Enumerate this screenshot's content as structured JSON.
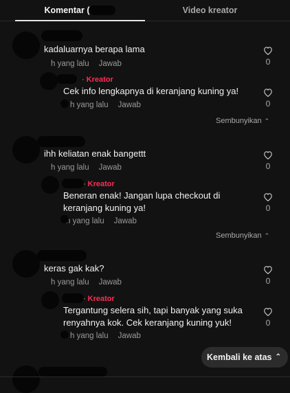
{
  "tabs": [
    {
      "label": "Komentar (",
      "active": true
    },
    {
      "label": "Video kreator",
      "active": false
    }
  ],
  "threads": [
    {
      "comment": {
        "text": "kadaluarnya berapa lama",
        "time": "h yang lalu",
        "reply": "Jawab",
        "likes": "0"
      },
      "creator_reply": {
        "badge": "Kreator",
        "text_lines": [
          "Cek info lengkapnya di keranjang kuning ya!"
        ],
        "time": "h yang lalu",
        "reply": "Jawab",
        "likes": "0"
      },
      "hide_label": "Sembunyikan"
    },
    {
      "comment": {
        "text": "ihh keliatan enak bangettt",
        "time": "h yang lalu",
        "reply": "Jawab",
        "likes": "0"
      },
      "creator_reply": {
        "badge": "Kreator",
        "text_lines": [
          "Beneran enak! Jangan lupa checkout di",
          "keranjang kuning ya!"
        ],
        "time": "h yang lalu",
        "reply": "Jawab",
        "likes": "0"
      },
      "hide_label": "Sembunyikan"
    },
    {
      "comment": {
        "text": "keras gak kak?",
        "time": "h yang lalu",
        "reply": "Jawab",
        "likes": "0"
      },
      "creator_reply": {
        "badge": "Kreator",
        "text_lines": [
          "Tergantung selera sih, tapi banyak yang suka",
          "renyahnya kok. Cek keranjang kuning yuk!"
        ],
        "time": "h yang lalu",
        "reply": "Jawab",
        "likes": "0"
      }
    }
  ],
  "back_to_top": "Kembali ke atas",
  "icons": {
    "like": "heart-outline-icon",
    "hide": "chevron-up-icon",
    "back": "double-chevron-up-icon"
  },
  "colors": {
    "background": "#121212",
    "kreator": "#fe2c55",
    "muted": "#9a9a9a"
  }
}
